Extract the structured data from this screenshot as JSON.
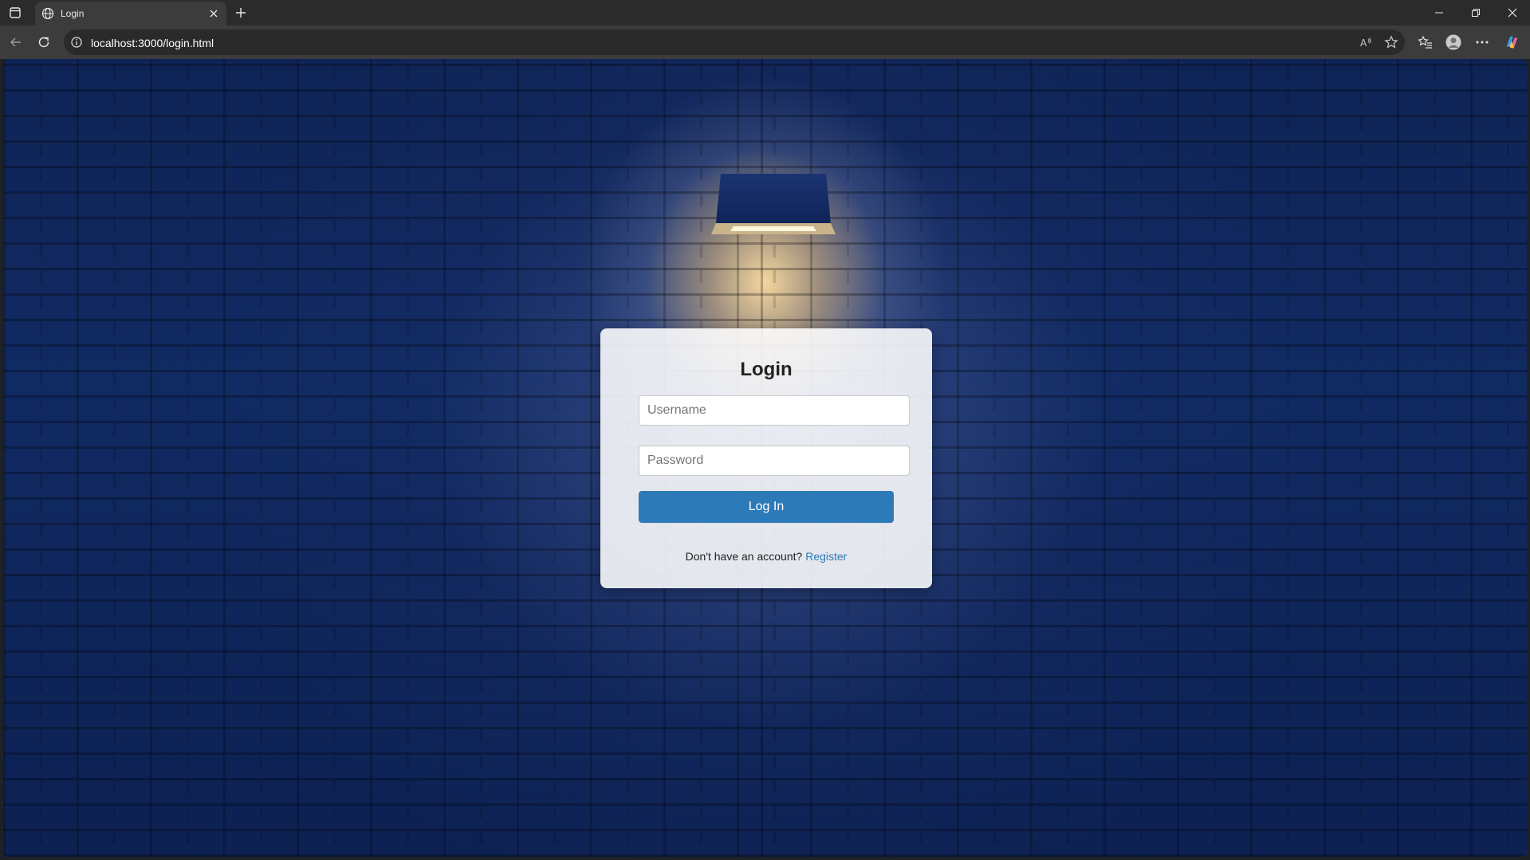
{
  "browser": {
    "tab": {
      "title": "Login",
      "favicon": "globe-icon"
    },
    "address": {
      "url": "localhost:3000/login.html"
    },
    "icons": {
      "sidebar": "tab-actions-icon",
      "close_tab": "close-icon",
      "new_tab": "plus-icon",
      "back": "back-arrow-icon",
      "refresh": "refresh-icon",
      "site_info": "info-icon",
      "read_aloud": "read-aloud-icon",
      "favorite": "star-icon",
      "favorites": "favorites-icon",
      "profile": "profile-icon",
      "more": "more-icon",
      "copilot": "copilot-icon",
      "minimize": "minimize-icon",
      "restore": "restore-icon",
      "close_window": "close-icon"
    }
  },
  "login": {
    "title": "Login",
    "username_placeholder": "Username",
    "password_placeholder": "Password",
    "submit_label": "Log In",
    "register_prompt": "Don't have an account?",
    "register_link": "Register"
  },
  "colors": {
    "primary_button": "#2d7ab8",
    "link": "#2d7ab8",
    "background_wall": "#102a62"
  }
}
